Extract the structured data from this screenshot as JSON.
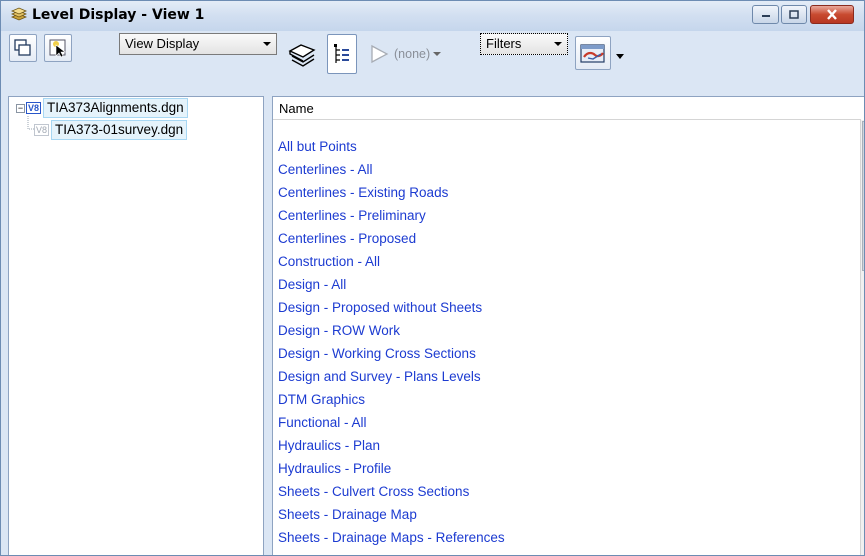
{
  "window": {
    "title": "Level Display - View 1"
  },
  "toolbar": {
    "display_mode": "View Display",
    "none_label": "(none)",
    "filters_label": "Filters"
  },
  "tree": {
    "items": [
      {
        "label": "TIA373Alignments.dgn",
        "expand": "⊟",
        "version": "V8"
      },
      {
        "label": "TIA373-01survey.dgn",
        "version": "V8"
      }
    ]
  },
  "list": {
    "header": "Name",
    "items": [
      "All but Points",
      "Centerlines - All",
      "Centerlines - Existing Roads",
      "Centerlines - Preliminary",
      "Centerlines - Proposed",
      "Construction - All",
      "Design - All",
      "Design - Proposed without Sheets",
      "Design - ROW Work",
      "Design - Working Cross Sections",
      "Design and Survey - Plans Levels",
      "DTM Graphics",
      "Functional - All",
      "Hydraulics - Plan",
      "Hydraulics - Profile",
      "Sheets - Culvert Cross Sections",
      "Sheets - Drainage Map",
      "Sheets - Drainage Maps - References"
    ]
  },
  "colors": {
    "link": "#1c3bd1",
    "selection": "#e5f3fb",
    "close_button": "#c84a30"
  },
  "icons": [
    "level-display-icon",
    "minimize-icon",
    "maximize-icon",
    "close-icon",
    "views-icon",
    "select-view-icon",
    "level-manager-icon",
    "tree-view-icon",
    "filter-arrow-icon",
    "symbology-icon"
  ]
}
